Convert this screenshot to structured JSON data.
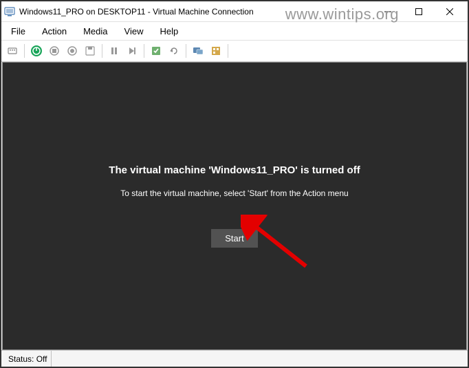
{
  "titlebar": {
    "title": "Windows11_PRO on DESKTOP11 - Virtual Machine Connection"
  },
  "watermark": "www.wintips.org",
  "menubar": {
    "file": "File",
    "action": "Action",
    "media": "Media",
    "view": "View",
    "help": "Help"
  },
  "vm": {
    "title": "The virtual machine 'Windows11_PRO' is turned off",
    "subtitle": "To start the virtual machine, select 'Start' from the Action menu",
    "start_label": "Start"
  },
  "statusbar": {
    "status": "Status: Off"
  }
}
